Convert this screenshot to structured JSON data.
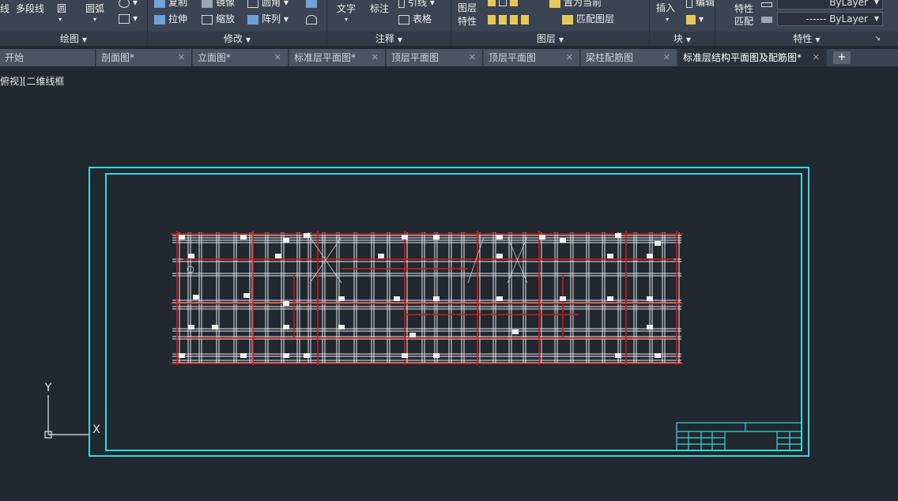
{
  "ribbon": {
    "draw": {
      "line_label": "线",
      "polyline_label": "多段线",
      "circle_label": "圆",
      "arc_label": "圆弧",
      "panel_title": "绘图"
    },
    "modify": {
      "copy_label": "复制",
      "mirror_label": "镜像",
      "fillet_label": "圆角",
      "stretch_label": "拉伸",
      "scale_label": "缩放",
      "array_label": "阵列",
      "panel_title": "修改"
    },
    "annotation": {
      "text_label": "文字",
      "dimension_label": "标注",
      "leader_label": "引线",
      "table_label": "表格",
      "panel_title": "注释"
    },
    "layers": {
      "layer_properties_line1": "图层",
      "layer_properties_line2": "特性",
      "set_current_label": "置为当前",
      "match_layer_label": "匹配图层",
      "panel_title": "图层"
    },
    "block": {
      "insert_label": "插入",
      "edit_label": "编辑",
      "panel_title": "块"
    },
    "properties": {
      "match_properties_line1": "特性",
      "match_properties_line2": "匹配",
      "color_value": "ByLayer",
      "linetype_value": "------ ByLayer",
      "panel_title": "特性"
    }
  },
  "tabs": [
    {
      "label": "开始"
    },
    {
      "label": "剖面图*"
    },
    {
      "label": "立面图*"
    },
    {
      "label": "标准层平面图*"
    },
    {
      "label": "顶层平面图"
    },
    {
      "label": "顶层平面图"
    },
    {
      "label": "梁柱配筋图"
    },
    {
      "label": "标准层结构平面图及配筋图*"
    }
  ],
  "tab_add_label": "+",
  "viewport_label": "俯视][二维线框",
  "ucs": {
    "x_label": "X",
    "y_label": "Y"
  },
  "colors": {
    "background": "#212830",
    "frame": "#36d7e0",
    "grid_white": "#e8e8e8",
    "beam_red": "#d01818"
  }
}
